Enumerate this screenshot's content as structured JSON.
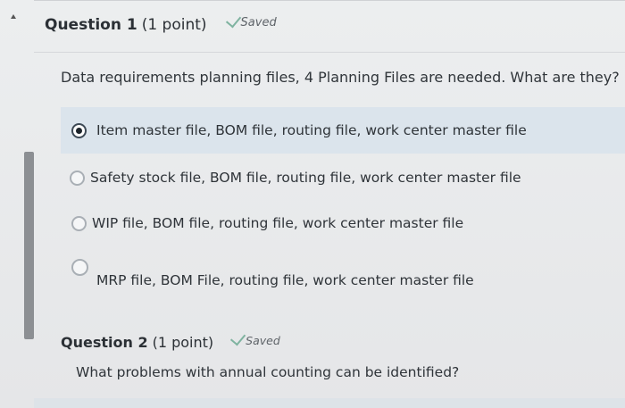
{
  "question1": {
    "title": "Question 1",
    "points": "(1 point)",
    "saved_label": "Saved",
    "prompt": "Data requirements planning files,  4 Planning Files are needed. What are they?",
    "options": [
      {
        "label": "Item master file, BOM file, routing file, work center master file",
        "selected": true
      },
      {
        "label": "Safety stock file, BOM file, routing file, work center master file",
        "selected": false
      },
      {
        "label": "WIP file, BOM file, routing file, work center master file",
        "selected": false
      },
      {
        "label": "MRP file, BOM File, routing file, work center master file",
        "selected": false
      }
    ]
  },
  "question2": {
    "title": "Question 2",
    "points": "(1 point)",
    "saved_label": "Saved",
    "prompt": "What problems with annual counting can be identified?"
  },
  "colors": {
    "selected_row_bg": "#dbe4ec",
    "saved_check": "#7fb3a0",
    "page_bg": "#e7e8ea"
  }
}
